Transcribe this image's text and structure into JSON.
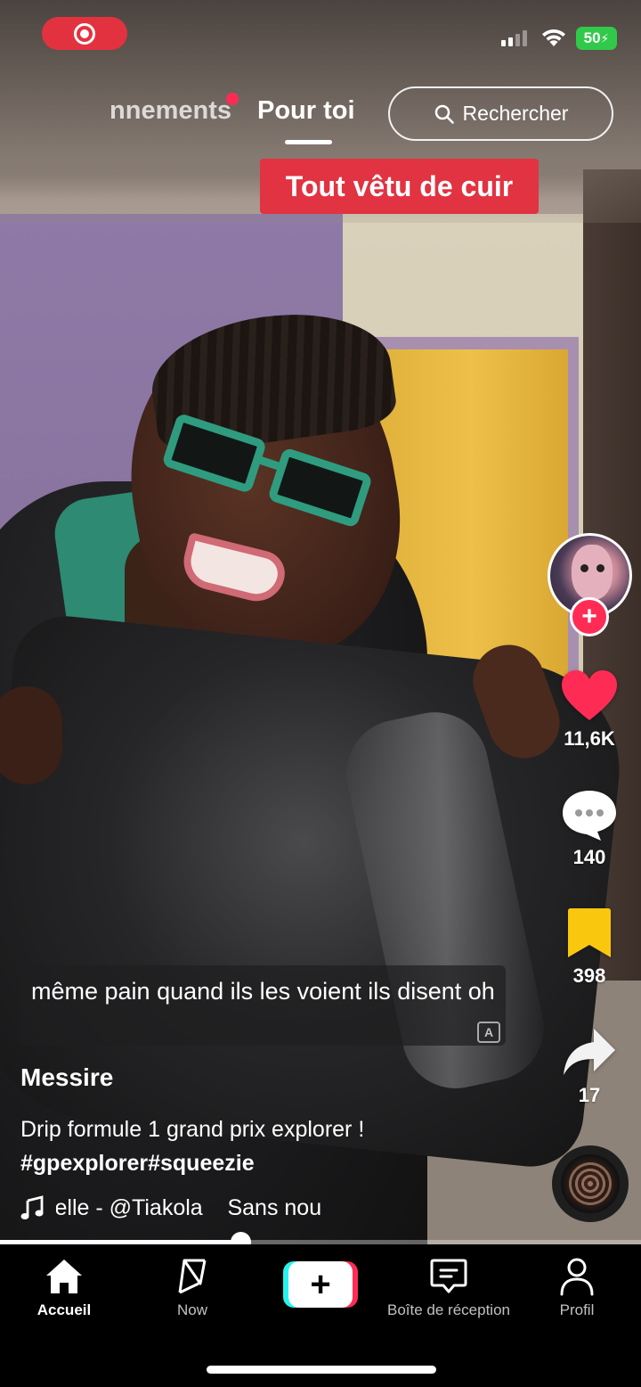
{
  "status_bar": {
    "recording_indicator": "screen-record-icon",
    "battery": "50"
  },
  "top_nav": {
    "tab_following": "Abonnements",
    "tab_following_visible": "nnements",
    "tab_foryou": "Pour toi",
    "search_label": "Rechercher"
  },
  "banner": "Tout vêtu de cuir",
  "video": {
    "subtitle": "même pain quand ils les voient ils disent oh",
    "author": "Messire",
    "description": "Drip formule 1 grand prix explorer !",
    "hashtags": "#gpexplorer#squeezie",
    "music_text": "velle - @Tiakola    Sans nou",
    "progress_fraction": 0.375
  },
  "actions": {
    "likes": "11,6K",
    "comments": "140",
    "saves": "398",
    "shares": "17"
  },
  "bottom_nav": {
    "home": "Accueil",
    "now": "Now",
    "inbox": "Boîte de réception",
    "profile": "Profil"
  },
  "colors": {
    "accent": "#fe2c55",
    "banner": "#e13341",
    "bookmark": "#f9c80e",
    "battery": "#31c94a"
  }
}
